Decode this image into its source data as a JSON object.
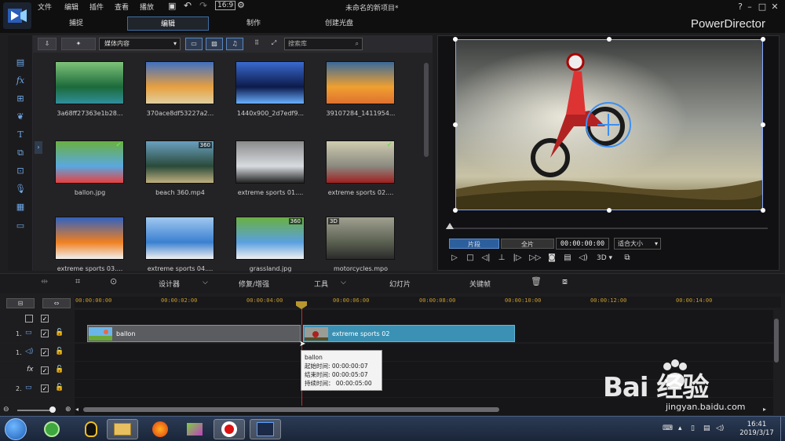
{
  "menu": [
    "文件",
    "编辑",
    "插件",
    "查看",
    "播放"
  ],
  "window_title": "未命名的新项目*",
  "brand": "PowerDirector",
  "mode_tabs": [
    {
      "label": "捕捉",
      "active": false
    },
    {
      "label": "编辑",
      "active": true
    },
    {
      "label": "制作",
      "active": false
    },
    {
      "label": "创建光盘",
      "active": false
    }
  ],
  "library": {
    "dropdown": "媒体内容",
    "search_placeholder": "搜索库",
    "items": [
      {
        "label": "3a68ff27363e1b28...",
        "palette": "forest"
      },
      {
        "label": "370ace8df53227a2...",
        "palette": "mountain"
      },
      {
        "label": "1440x900_2d7edf9...",
        "palette": "night"
      },
      {
        "label": "39107284_1411954...",
        "palette": "sunset"
      },
      {
        "label": "ballon.jpg",
        "palette": "balloon",
        "check": true
      },
      {
        "label": "beach 360.mp4",
        "palette": "beach",
        "badge": "360"
      },
      {
        "label": "extreme sports 01....",
        "palette": "bike"
      },
      {
        "label": "extreme sports 02....",
        "palette": "moto",
        "check": true
      },
      {
        "label": "extreme sports 03....",
        "palette": "surf"
      },
      {
        "label": "extreme sports 04....",
        "palette": "sky"
      },
      {
        "label": "grassland.jpg",
        "palette": "grass",
        "badge": "360"
      },
      {
        "label": "motorcycles.mpo",
        "palette": "motos",
        "badge": "3D"
      }
    ]
  },
  "preview": {
    "mode_clip": "片段",
    "mode_movie": "全片",
    "timecode": "00:00:00:00",
    "fit": "适合大小",
    "threed": "3D"
  },
  "edit_toolbar": {
    "designer": "设计器",
    "fix": "修复/增强",
    "tools": "工具",
    "slideshow": "幻灯片",
    "keyframe": "关键帧"
  },
  "timeline": {
    "ticks": [
      "00:00:00:00",
      "00:00:02:00",
      "00:00:04:00",
      "00:00:06:00",
      "00:00:08:00",
      "00:00:10:00",
      "00:00:12:00",
      "00:00:14:00"
    ],
    "tracks": [
      {
        "num": "",
        "icon": "",
        "kind": "master"
      },
      {
        "num": "1.",
        "icon": "▭",
        "kind": "video"
      },
      {
        "num": "1.",
        "icon": "◁)",
        "kind": "audio"
      },
      {
        "num": "",
        "icon": "fx",
        "kind": "fx"
      },
      {
        "num": "2.",
        "icon": "▭",
        "kind": "video"
      },
      {
        "num": "",
        "icon": "",
        "kind": "partial"
      }
    ],
    "clips": [
      {
        "label": "ballon"
      },
      {
        "label": "extreme sports 02"
      }
    ],
    "tooltip": {
      "title": "ballon",
      "start": "起始时间: 00:00:00:07",
      "end": "结束时间: 00:00:05:07",
      "duration": "持续时间： 00:00:05:00"
    }
  },
  "taskbar": {
    "time": "16:41",
    "date": "2019/3/17"
  },
  "watermark": {
    "text": "Bai  经验",
    "url": "jingyan.baidu.com"
  },
  "colors": {
    "accent": "#3e6fa3",
    "clip_video": "#3a91b4",
    "clip_image": "#5a5c60",
    "playhead": "#c03030",
    "timecode_tick": "#c69a2e"
  }
}
